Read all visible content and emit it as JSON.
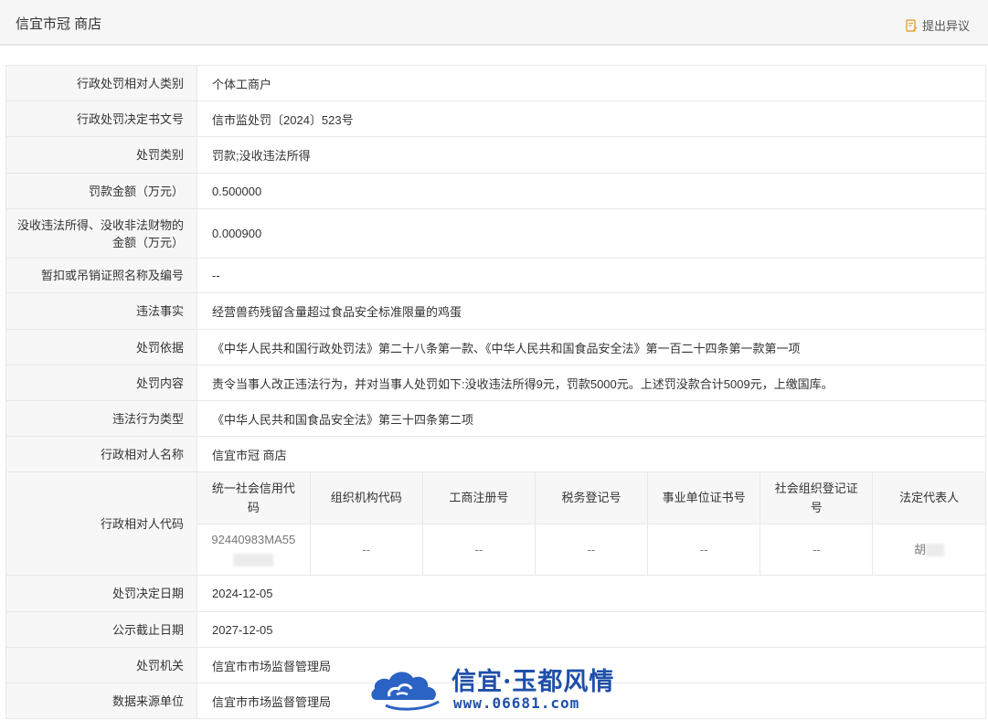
{
  "header": {
    "title": "信宜市冠  商店",
    "dispute_label": "提出异议"
  },
  "rows": [
    {
      "label": "行政处罚相对人类别",
      "value": "个体工商户"
    },
    {
      "label": "行政处罚决定书文号",
      "value": "信市监处罚〔2024〕523号"
    },
    {
      "label": "处罚类别",
      "value": "罚款;没收违法所得"
    },
    {
      "label": "罚款金额（万元）",
      "value": "0.500000"
    },
    {
      "label": "没收违法所得、没收非法财物的金额（万元）",
      "value": "0.000900"
    },
    {
      "label": "暂扣或吊销证照名称及编号",
      "value": "--"
    },
    {
      "label": "违法事实",
      "value": "经营兽药残留含量超过食品安全标准限量的鸡蛋"
    },
    {
      "label": "处罚依据",
      "value": "《中华人民共和国行政处罚法》第二十八条第一款、《中华人民共和国食品安全法》第一百二十四条第一款第一项"
    },
    {
      "label": "处罚内容",
      "value": "责令当事人改正违法行为，并对当事人处罚如下:没收违法所得9元，罚款5000元。上述罚没款合计5009元，上缴国库。"
    },
    {
      "label": "违法行为类型",
      "value": "《中华人民共和国食品安全法》第三十四条第二项"
    },
    {
      "label": "行政相对人名称",
      "value": "信宜市冠  商店"
    }
  ],
  "codes": {
    "label": "行政相对人代码",
    "headers": [
      "统一社会信用代码",
      "组织机构代码",
      "工商注册号",
      "税务登记号",
      "事业单位证书号",
      "社会组织登记证号",
      "法定代表人"
    ],
    "values": [
      "92440983MA55",
      "--",
      "--",
      "--",
      "--",
      "--",
      "胡"
    ]
  },
  "rows_after": [
    {
      "label": "处罚决定日期",
      "value": "2024-12-05"
    },
    {
      "label": "公示截止日期",
      "value": "2027-12-05"
    },
    {
      "label": "处罚机关",
      "value": "信宜市市场监督管理局"
    },
    {
      "label": "数据来源单位",
      "value": "信宜市市场监督管理局"
    }
  ],
  "watermark": {
    "text": "信宜·玉都风情",
    "url": "www.06681.com"
  },
  "colors": {
    "label_bg": "#f7f7f7",
    "border": "#e8e8e8",
    "dispute_icon": "#e8a33d",
    "watermark": "#1f4fa8"
  }
}
